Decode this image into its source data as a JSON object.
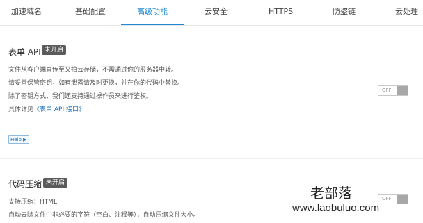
{
  "tabs": [
    {
      "label": "加速域名"
    },
    {
      "label": "基础配置"
    },
    {
      "label": "高级功能"
    },
    {
      "label": "云安全"
    },
    {
      "label": "HTTPS"
    },
    {
      "label": "防盗链"
    },
    {
      "label": "云处理"
    }
  ],
  "active_tab": "高级功能",
  "form_api": {
    "title": "表单 API",
    "status": "未开启",
    "lines": [
      "文件从客户端直传至又拍云存储，不需通过你的服务器中转。",
      "请妥善保管密钥，如有泄露请及时更换，并在你的代码中替换。",
      "除了密钥方式，我们还支持通过操作员来进行鉴权。"
    ],
    "detail_prefix": "具体详见",
    "detail_link": "《表单 API 接口》",
    "toggle_label": "OFF",
    "help_label": "Help ▶"
  },
  "code_compress": {
    "title": "代码压缩",
    "status": "未开启",
    "lines": [
      "支持压缩：HTML",
      "自动去除文件中非必要的字符（空白、注释等），自动压缩文件大小。"
    ],
    "toggle_label": "OFF"
  },
  "watermark": {
    "name": "老部落",
    "url": "www.laobuluo.com"
  },
  "colors": {
    "accent": "#1e88d6",
    "badge_bg": "#5b5b5b",
    "link": "#1e6fb8"
  }
}
